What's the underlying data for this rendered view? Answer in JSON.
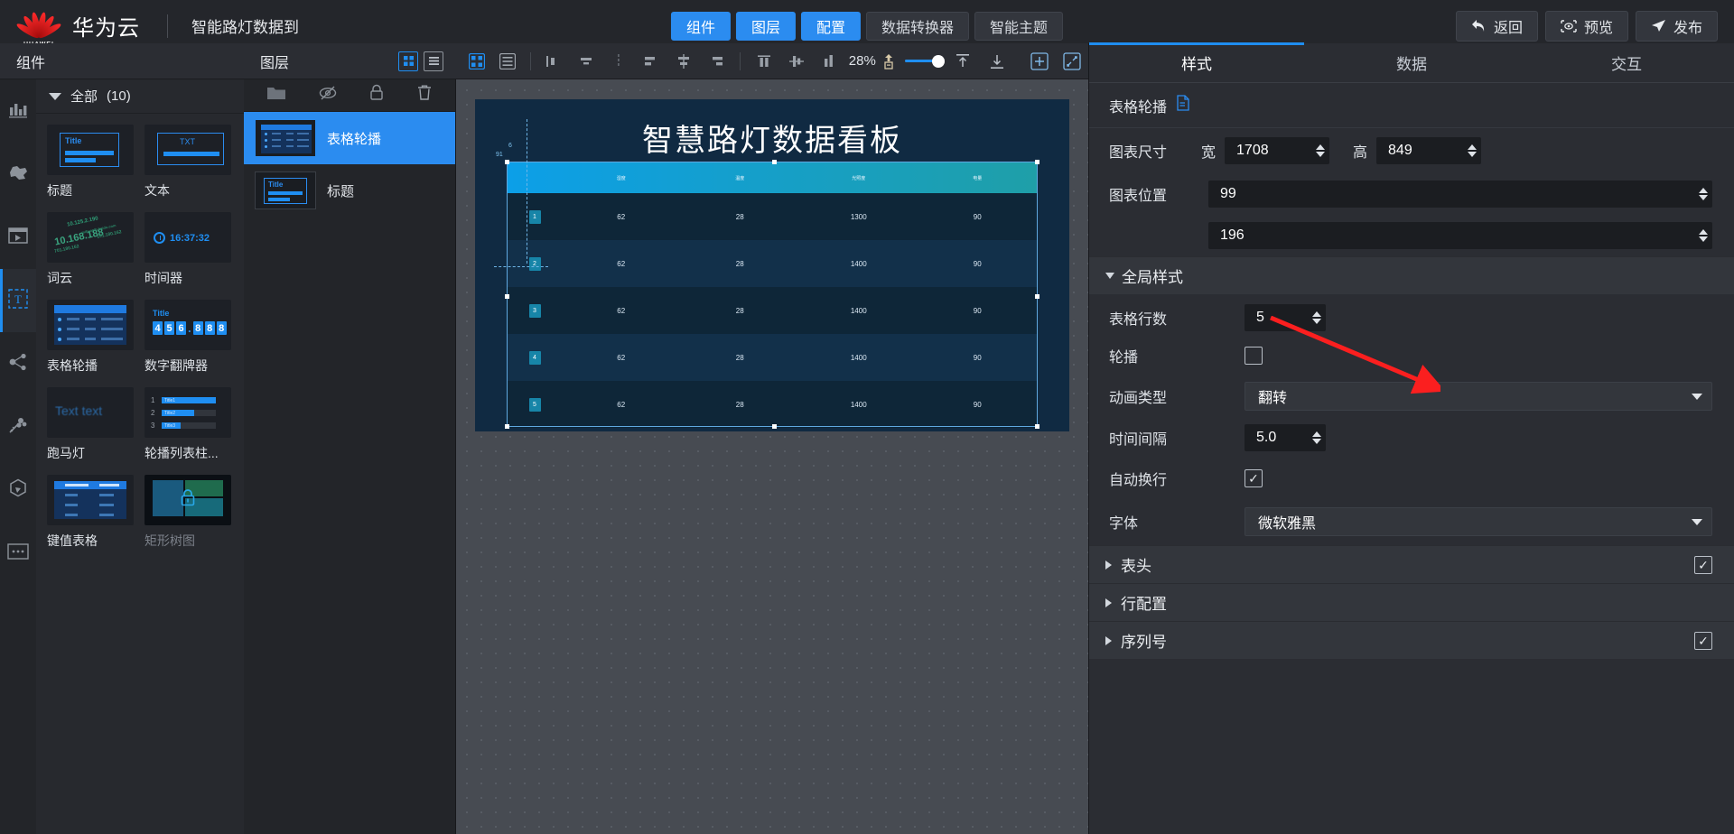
{
  "topbar": {
    "logo_text": "HUAWEI",
    "brand": "华为云",
    "project_title": "智能路灯数据到",
    "tabs": [
      {
        "label": "组件",
        "active": true
      },
      {
        "label": "图层",
        "active": true
      },
      {
        "label": "配置",
        "active": true
      },
      {
        "label": "数据转换器",
        "active": false
      },
      {
        "label": "智能主题",
        "active": false
      }
    ],
    "actions": [
      {
        "label": "返回",
        "icon": "back-arrow-icon"
      },
      {
        "label": "预览",
        "icon": "eye-icon"
      },
      {
        "label": "发布",
        "icon": "send-icon"
      }
    ],
    "accent": "#2b8cf0"
  },
  "rail": {
    "items": [
      {
        "name": "chart-icon",
        "active": false
      },
      {
        "name": "map-icon",
        "active": false
      },
      {
        "name": "media-icon",
        "active": false
      },
      {
        "name": "text-icon",
        "active": true
      },
      {
        "name": "relation-icon",
        "active": false
      },
      {
        "name": "decoration-icon",
        "active": false
      },
      {
        "name": "material-icon",
        "active": false
      },
      {
        "name": "more-icon",
        "active": false
      }
    ]
  },
  "components": {
    "panel_title": "组件",
    "group_label": "全部",
    "group_count": "(10)",
    "items": [
      {
        "label": "标题",
        "thumb": "title-thumb",
        "locked": false
      },
      {
        "label": "文本",
        "thumb": "text-thumb",
        "locked": false
      },
      {
        "label": "词云",
        "thumb": "wordcloud-thumb",
        "locked": false
      },
      {
        "label": "时间器",
        "thumb": "timer-thumb",
        "locked": false,
        "thumb_text": "16:37:32"
      },
      {
        "label": "表格轮播",
        "thumb": "table-carousel-thumb",
        "locked": false
      },
      {
        "label": "数字翻牌器",
        "thumb": "flipper-thumb",
        "locked": false,
        "thumb_text": "456.888",
        "thumb_title": "Title"
      },
      {
        "label": "跑马灯",
        "thumb": "marquee-thumb",
        "locked": false,
        "thumb_text": "Text text"
      },
      {
        "label": "轮播列表柱...",
        "thumb": "carousel-list-thumb",
        "locked": false
      },
      {
        "label": "键值表格",
        "thumb": "kv-table-thumb",
        "locked": false
      },
      {
        "label": "矩形树图",
        "thumb": "treemap-thumb",
        "locked": true
      }
    ],
    "thumb_title_text": "Title",
    "thumb_txt_text": "TXT",
    "wordcloud_words": [
      "10.168.188",
      "10.125.2.190",
      "701.180.162",
      "101.180.162",
      "mihuan'b.baidu.com"
    ],
    "list_items": [
      {
        "n": "1",
        "label": "Title1",
        "pct": 100
      },
      {
        "n": "2",
        "label": "Title2",
        "pct": 60
      },
      {
        "n": "3",
        "label": "Title3",
        "pct": 34
      }
    ]
  },
  "layers": {
    "panel_title": "图层",
    "view_grid_icon": "grid-view-icon",
    "view_list_icon": "list-view-icon",
    "tools": [
      {
        "name": "folder-icon"
      },
      {
        "name": "eye-off-icon"
      },
      {
        "name": "lock-icon"
      },
      {
        "name": "trash-icon"
      }
    ],
    "items": [
      {
        "label": "表格轮播",
        "selected": true,
        "thumb": "table-carousel-thumb"
      },
      {
        "label": "标题",
        "selected": false,
        "thumb": "title-thumb"
      }
    ]
  },
  "canvas_toolbar": {
    "view_grid_icon": "grid-view-icon",
    "view_list_icon": "list-view-icon",
    "align_icons": [
      "align-left-icon",
      "align-center-h-icon",
      "align-right-icon",
      "distribute-left-icon",
      "align-middle-icon",
      "distribute-right-icon",
      "align-top-icon",
      "align-center-v-icon",
      "align-bottom-icon"
    ],
    "zoom_label": "28%",
    "fit_icon": "fit-screen-icon",
    "align_top_icon": "vertical-top-icon",
    "align_bottom_icon": "vertical-bottom-icon",
    "add_icon": "add-icon",
    "fullscreen_icon": "fullscreen-icon",
    "zoom_percent": 28
  },
  "canvas": {
    "dashboard_title": "智慧路灯数据看板",
    "table": {
      "columns": [
        "",
        "湿度",
        "温度",
        "光照度",
        "电量"
      ],
      "rows": [
        {
          "idx": "1",
          "values": [
            "62",
            "28",
            "1300",
            "90"
          ]
        },
        {
          "idx": "2",
          "values": [
            "62",
            "28",
            "1400",
            "90"
          ]
        },
        {
          "idx": "3",
          "values": [
            "62",
            "28",
            "1400",
            "90"
          ]
        },
        {
          "idx": "4",
          "values": [
            "62",
            "28",
            "1400",
            "90"
          ]
        },
        {
          "idx": "5",
          "values": [
            "62",
            "28",
            "1400",
            "90"
          ]
        }
      ]
    },
    "guide_labels": [
      "6",
      "91"
    ]
  },
  "props": {
    "tabs": [
      {
        "label": "样式",
        "active": true
      },
      {
        "label": "数据",
        "active": false
      },
      {
        "label": "交互",
        "active": false
      }
    ],
    "component_name": "表格轮播",
    "doc_icon": "document-icon",
    "size_label": "图表尺寸",
    "width_label": "宽",
    "width_value": "1708",
    "height_label": "高",
    "height_value": "849",
    "position_label": "图表位置",
    "position_x": "99",
    "position_y": "196",
    "global_style_label": "全局样式",
    "rows_label": "表格行数",
    "rows_value": "5",
    "carousel_label": "轮播",
    "carousel_checked": false,
    "anim_label": "动画类型",
    "anim_value": "翻转",
    "interval_label": "时间间隔",
    "interval_value": "5.0",
    "wrap_label": "自动换行",
    "wrap_checked": true,
    "font_label": "字体",
    "font_value": "微软雅黑",
    "sections": [
      {
        "label": "表头",
        "checked": true,
        "has_check": true
      },
      {
        "label": "行配置",
        "checked": false,
        "has_check": false
      },
      {
        "label": "序列号",
        "checked": true,
        "has_check": true
      }
    ]
  }
}
